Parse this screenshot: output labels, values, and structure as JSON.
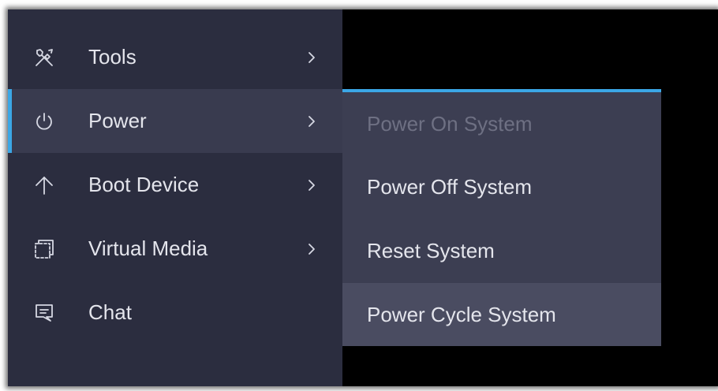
{
  "menu": {
    "items": [
      {
        "label": "Tools",
        "icon": "tools-icon",
        "has_submenu": true,
        "active": false
      },
      {
        "label": "Power",
        "icon": "power-icon",
        "has_submenu": true,
        "active": true
      },
      {
        "label": "Boot Device",
        "icon": "arrow-up-icon",
        "has_submenu": true,
        "active": false
      },
      {
        "label": "Virtual Media",
        "icon": "virtual-media-icon",
        "has_submenu": true,
        "active": false
      },
      {
        "label": "Chat",
        "icon": "chat-icon",
        "has_submenu": false,
        "active": false
      }
    ]
  },
  "submenu": {
    "parent": "Power",
    "items": [
      {
        "label": "Power On System",
        "state": "disabled"
      },
      {
        "label": "Power Off System",
        "state": "normal"
      },
      {
        "label": "Reset System",
        "state": "normal"
      },
      {
        "label": "Power Cycle System",
        "state": "hover"
      }
    ]
  },
  "colors": {
    "menu_background": "#2b2d3f",
    "active_item_background": "#393b4f",
    "submenu_background": "#3c3e52",
    "hover_item_background": "#4a4c61",
    "accent": "#3ba7e6",
    "text": "#e4e5ec",
    "disabled_text": "#6e7083",
    "screen_background": "#000000"
  }
}
